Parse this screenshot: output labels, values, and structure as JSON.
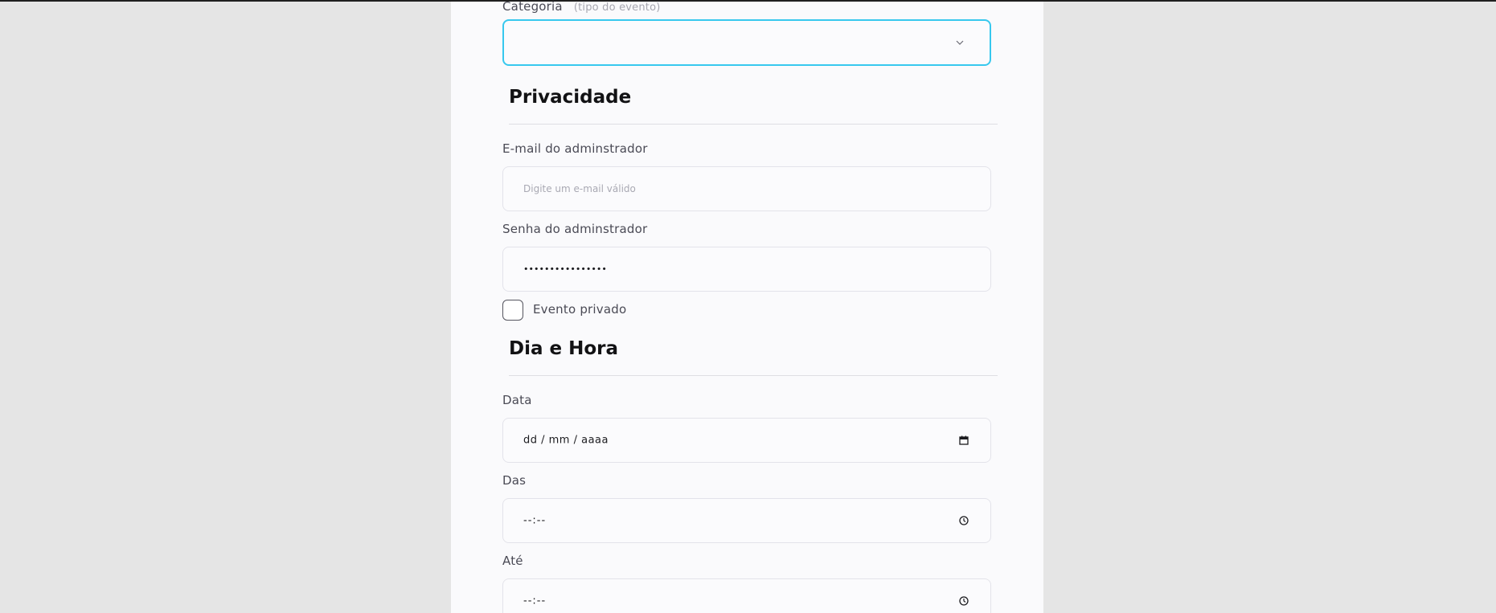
{
  "category": {
    "label": "Categoria",
    "hint": "(tipo do evento)",
    "selected_value": ""
  },
  "privacy": {
    "title": "Privacidade",
    "email_label": "E-mail do adminstrador",
    "email_placeholder": "Digite um e-mail válido",
    "password_label": "Senha do adminstrador",
    "password_value": "••••••••••••••••",
    "private_checkbox_label": "Evento privado",
    "private_checked": false
  },
  "datetime": {
    "title": "Dia e Hora",
    "date_label": "Data",
    "date_value": "dd / mm / aaaa",
    "from_label": "Das",
    "from_value": "--:--",
    "to_label": "Até",
    "to_value": "--:--"
  },
  "colors": {
    "page_bg": "#e5e5e5",
    "panel_bg": "#fafafc",
    "focus_border": "#37c8ee",
    "field_border": "#e3e3ea"
  },
  "icons": {
    "select": "chevron-down-icon",
    "date": "calendar-icon",
    "time": "clock-icon"
  }
}
